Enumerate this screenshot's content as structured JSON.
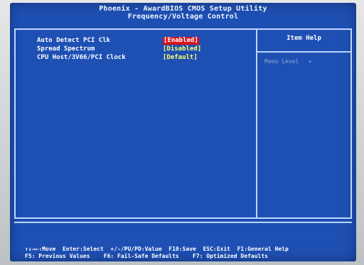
{
  "bios": {
    "title_line1": "Phoenix - AwardBIOS CMOS Setup Utility",
    "title_line2": "Frequency/Voltage Control",
    "settings": [
      {
        "label": "Auto Detect PCI Clk",
        "value": "[Enabled]"
      },
      {
        "label": "Spread Spectrum",
        "value": "[Disabled]"
      },
      {
        "label": "CPU Host/3V66/PCI Clock",
        "value": "[Default]"
      }
    ],
    "help": {
      "header": "Item Help",
      "menu_level": "Menu Level   ►"
    },
    "footer": {
      "line1": "↑↓→←:Move  Enter:Select  +/-/PU/PD:Value  F10:Save  ESC:Exit  F1:General Help",
      "line2": "F5: Previous Values    F6: Fail-Safe Defaults    F7: Optimized Defaults"
    }
  },
  "colors": {
    "background": "#1e50b4",
    "border": "#bcd6ff",
    "value_text": "#ffff6a",
    "selected_background": "#d6141e"
  }
}
